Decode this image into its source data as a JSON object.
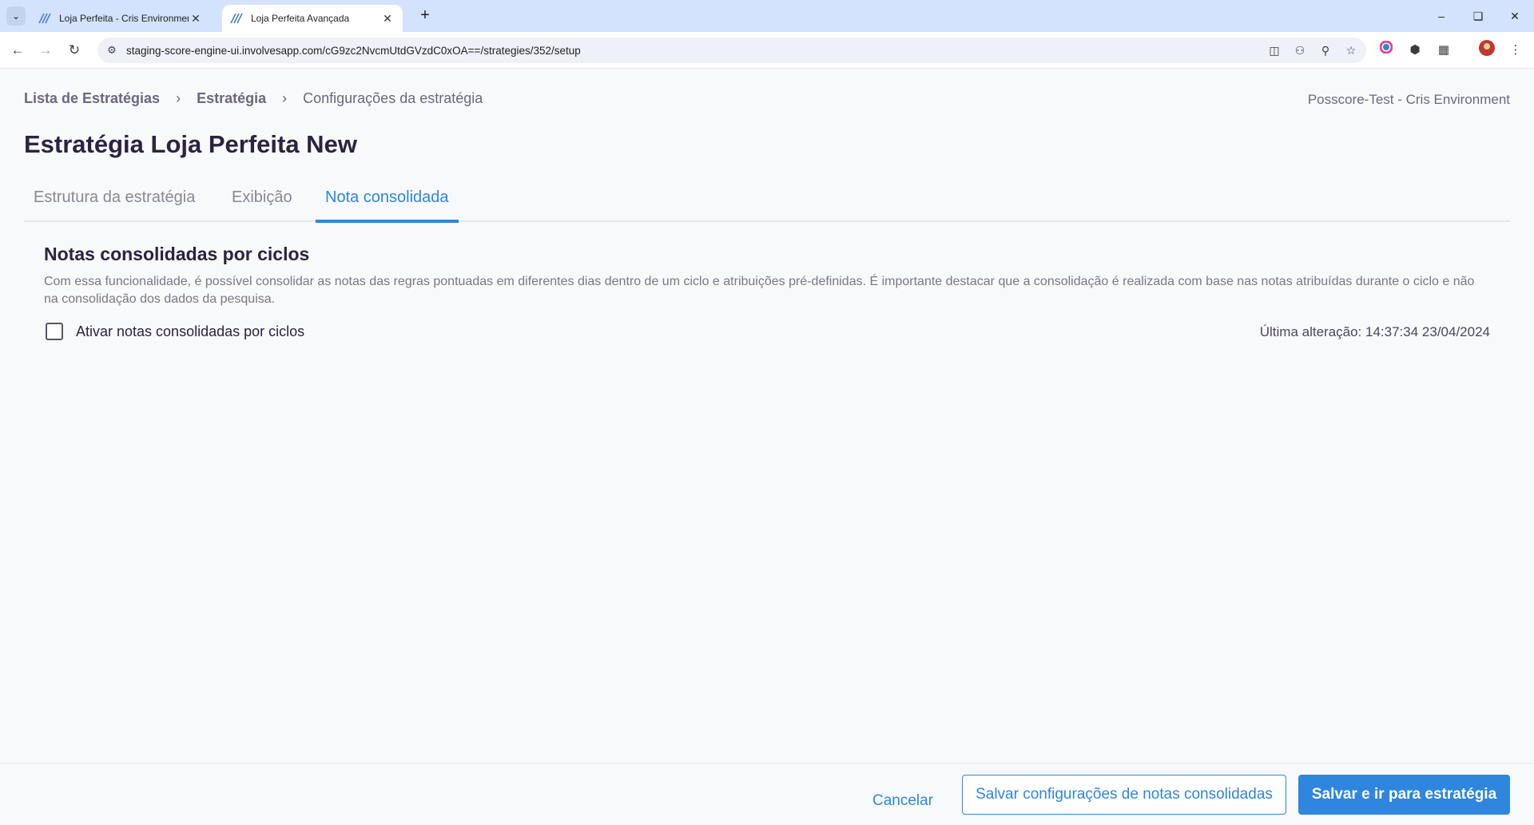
{
  "browser": {
    "tabs": [
      {
        "title": "Loja Perfeita - Cris Environmen",
        "active": false
      },
      {
        "title": "Loja Perfeita Avançada",
        "active": true
      }
    ],
    "url": "staging-score-engine-ui.involvesapp.com/cG9zc2NvcmUtdGVzdC0xOA==/strategies/352/setup"
  },
  "breadcrumb": {
    "items": [
      "Lista de Estratégias",
      "Estratégia"
    ],
    "current": "Configurações da estratégia"
  },
  "environment": "Posscore-Test - Cris Environment",
  "page": {
    "title": "Estratégia Loja Perfeita New",
    "tabs": [
      "Estrutura da estratégia",
      "Exibição",
      "Nota consolidada"
    ],
    "active_tab": "Nota consolidada"
  },
  "section": {
    "title": "Notas consolidadas por ciclos",
    "description": "Com essa funcionalidade, é possível consolidar as notas das regras pontuadas em diferentes dias dentro de um ciclo e atribuições pré-definidas. É importante destacar que a consolidação é realizada com base nas notas atribuídas durante o ciclo e não na consolidação dos dados da pesquisa.",
    "checkbox_label": "Ativar notas consolidadas por ciclos",
    "checkbox_checked": false,
    "last_change": "Última alteração: 14:37:34 23/04/2024"
  },
  "footer": {
    "cancel": "Cancelar",
    "save_consolidated": "Salvar configurações de notas consolidadas",
    "save_and_go": "Salvar e ir para estratégia"
  },
  "colors": {
    "accent": "#2e86de",
    "text_dark": "#2b2340",
    "text_muted": "#7a7788"
  }
}
